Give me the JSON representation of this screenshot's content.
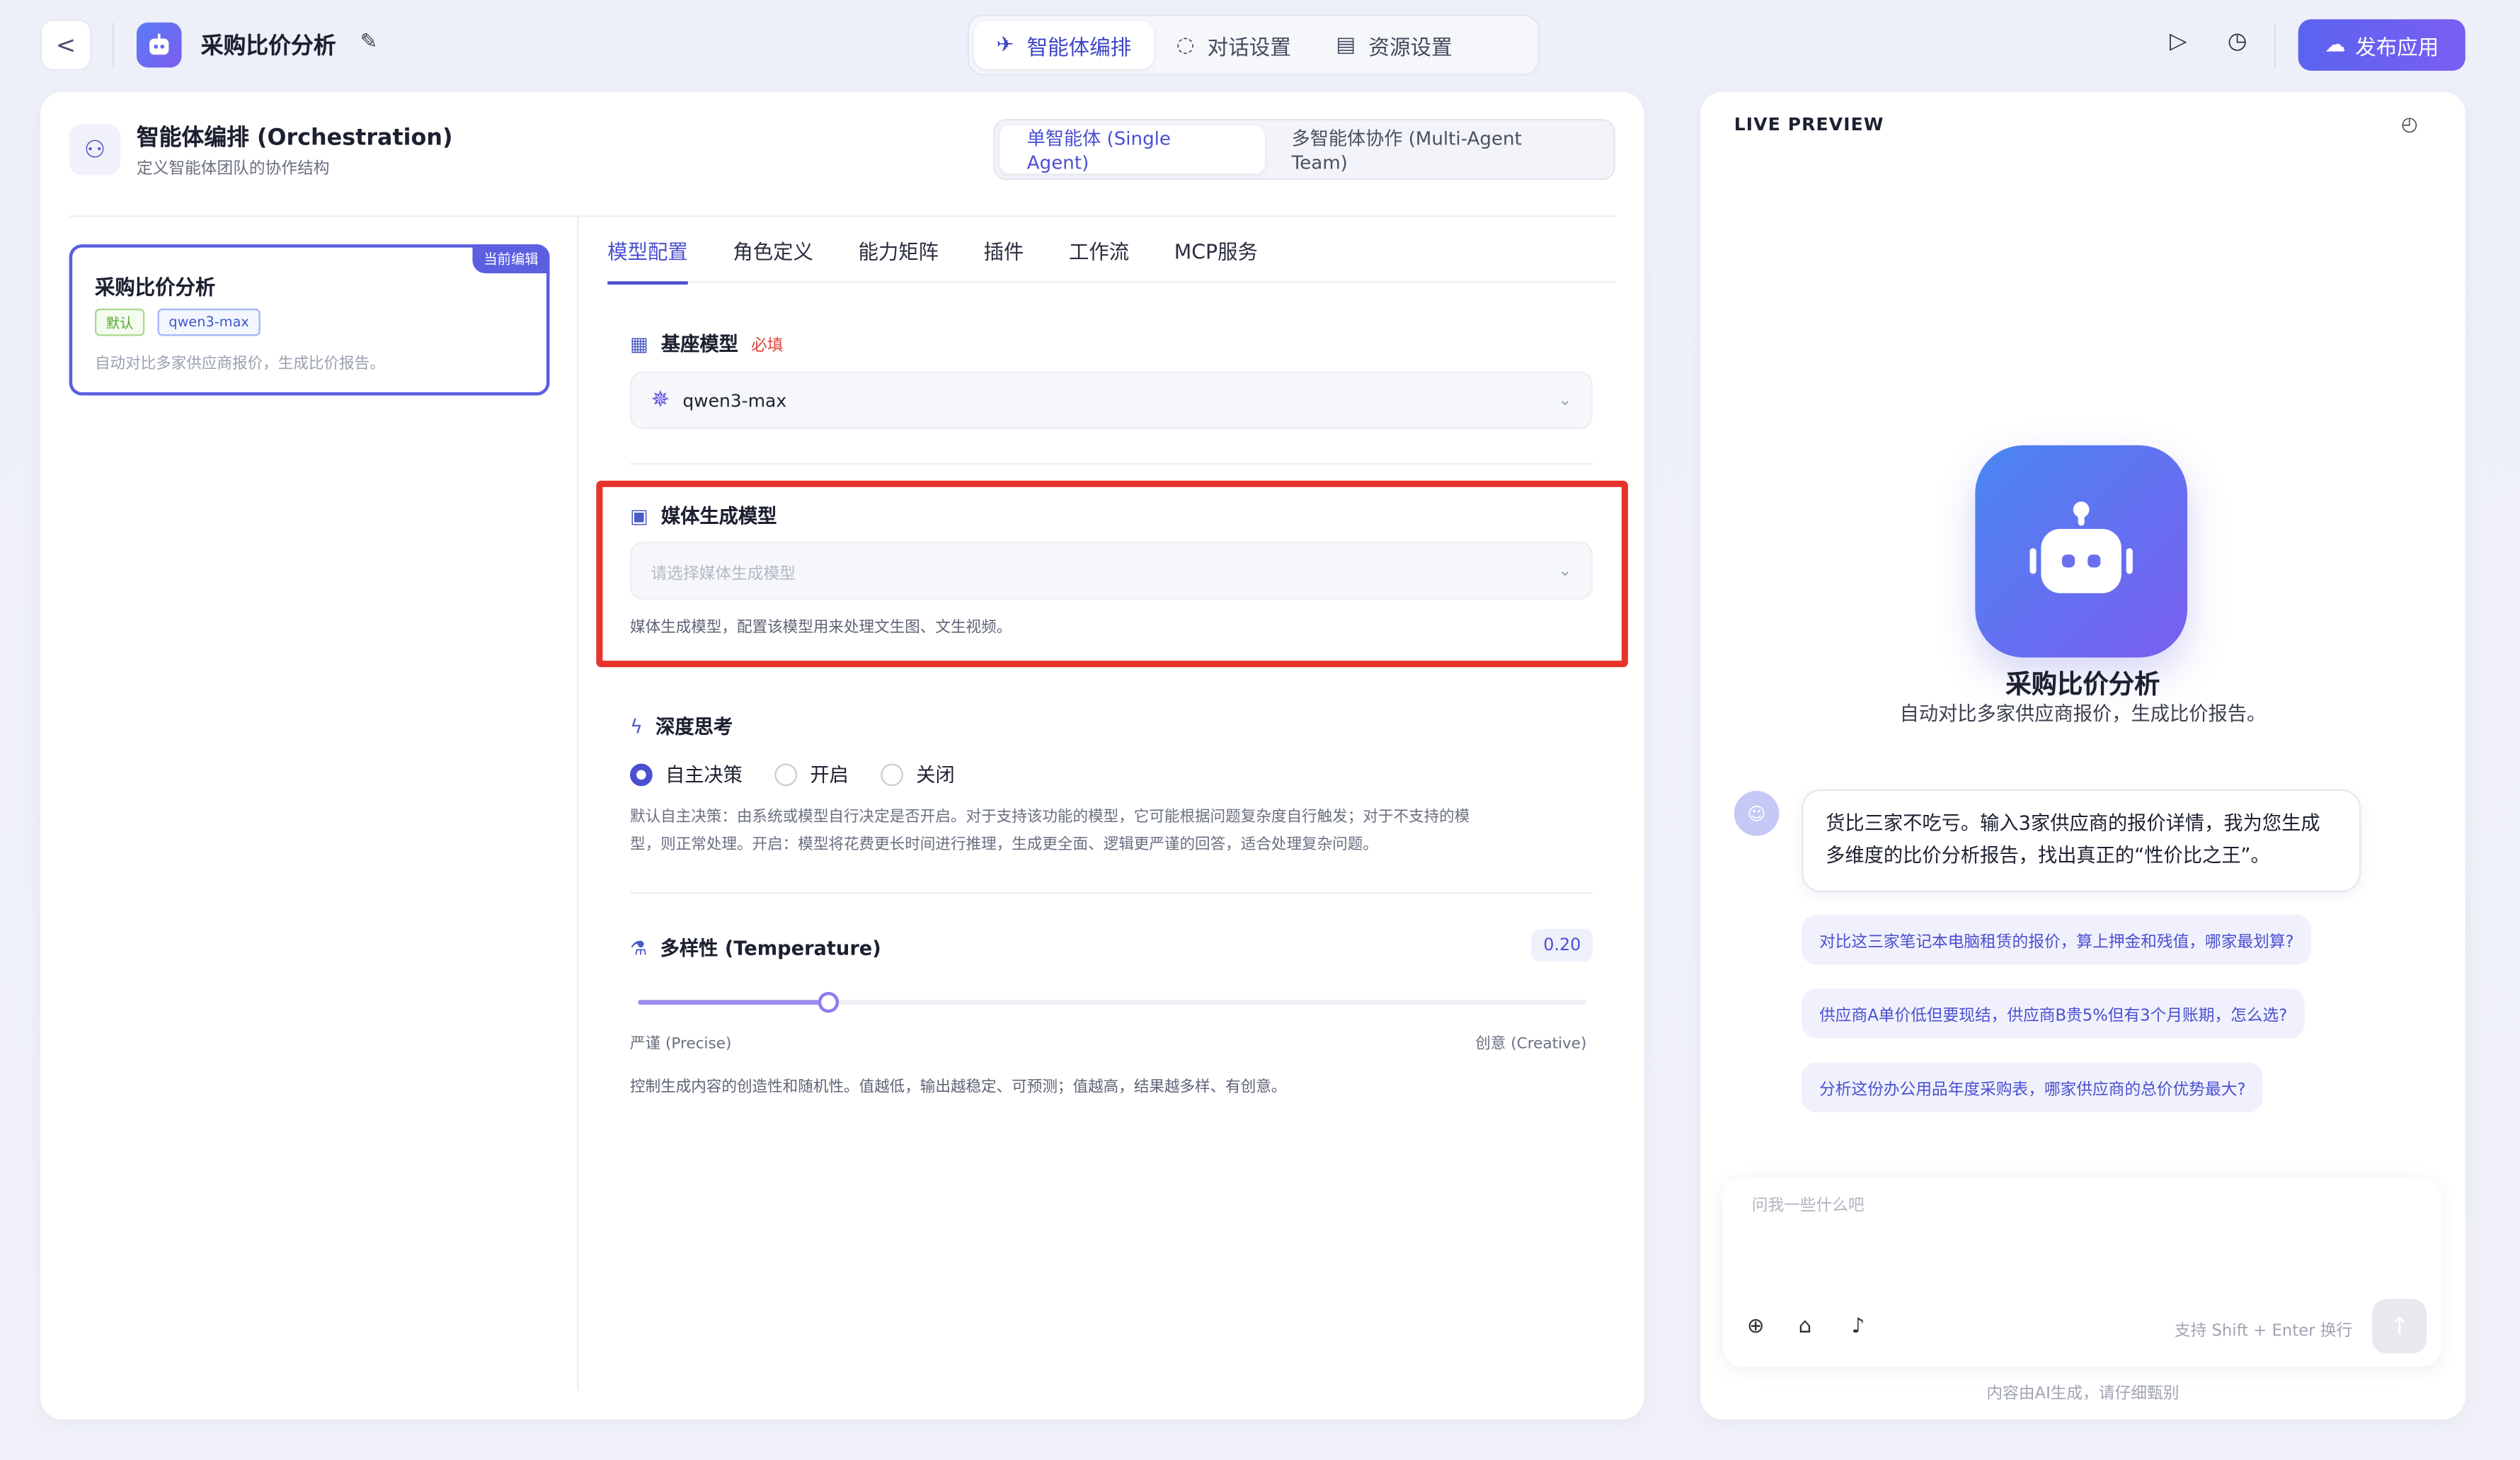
{
  "header": {
    "back_glyph": "<",
    "app_title": "采购比价分析",
    "tabs": [
      {
        "label": "智能体编排",
        "icon": "rocket-icon",
        "active": true
      },
      {
        "label": "对话设置",
        "icon": "chat-icon",
        "active": false
      },
      {
        "label": "资源设置",
        "icon": "list-icon",
        "active": false
      }
    ],
    "publish_label": "发布应用"
  },
  "orchestration": {
    "title": "智能体编排 (Orchestration)",
    "subtitle": "定义智能体团队的协作结构",
    "modes": [
      {
        "label": "单智能体 (Single Agent)",
        "active": true
      },
      {
        "label": "多智能体协作 (Multi-Agent Team)",
        "active": false
      }
    ]
  },
  "agent_card": {
    "badge": "当前编辑",
    "name": "采购比价分析",
    "tag_default": "默认",
    "tag_model": "qwen3-max",
    "description": "自动对比多家供应商报价，生成比价报告。"
  },
  "sub_tabs": [
    {
      "label": "模型配置",
      "active": true
    },
    {
      "label": "角色定义",
      "active": false
    },
    {
      "label": "能力矩阵",
      "active": false
    },
    {
      "label": "插件",
      "active": false
    },
    {
      "label": "工作流",
      "active": false
    },
    {
      "label": "MCP服务",
      "active": false
    }
  ],
  "base_model": {
    "label": "基座模型",
    "required": "必填",
    "value": "qwen3-max"
  },
  "media_model": {
    "label": "媒体生成模型",
    "placeholder": "请选择媒体生成模型",
    "hint": "媒体生成模型，配置该模型用来处理文生图、文生视频。"
  },
  "deep_thinking": {
    "label": "深度思考",
    "options": [
      {
        "label": "自主决策",
        "selected": true
      },
      {
        "label": "开启",
        "selected": false
      },
      {
        "label": "关闭",
        "selected": false
      }
    ],
    "description_line1": "默认自主决策：由系统或模型自行决定是否开启。对于支持该功能的模型，它可能根据问题复杂度自行触发；对于不支持的模",
    "description_line2": "型，则正常处理。开启：模型将花费更长时间进行推理，生成更全面、逻辑更严谨的回答，适合处理复杂问题。"
  },
  "temperature": {
    "label": "多样性 (Temperature)",
    "value": 0.2,
    "value_text": "0.20",
    "min_label": "严谨 (Precise)",
    "max_label": "创意 (Creative)",
    "description": "控制生成内容的创造性和随机性。值越低，输出越稳定、可预测；值越高，结果越多样、有创意。"
  },
  "preview": {
    "title": "LIVE PREVIEW",
    "agent_name": "采购比价分析",
    "agent_desc": "自动对比多家供应商报价，生成比价报告。",
    "greeting": "货比三家不吃亏。输入3家供应商的报价详情，我为您生成多维度的比价分析报告，找出真正的“性价比之王”。",
    "suggestions": [
      "对比这三家笔记本电脑租赁的报价，算上押金和残值，哪家最划算?",
      "供应商A单价低但要现结，供应商B贵5%但有3个月账期，怎么选?",
      "分析这份办公用品年度采购表，哪家供应商的总价优势最大?"
    ],
    "input_placeholder": "问我一些什么吧",
    "enter_hint": "支持 Shift + Enter 换行",
    "ai_note": "内容由AI生成，请仔细甄别"
  },
  "colors": {
    "accent": "#4b4fd0",
    "highlight_border": "#e7332b",
    "publish_gradient_start": "#5b63f0"
  }
}
